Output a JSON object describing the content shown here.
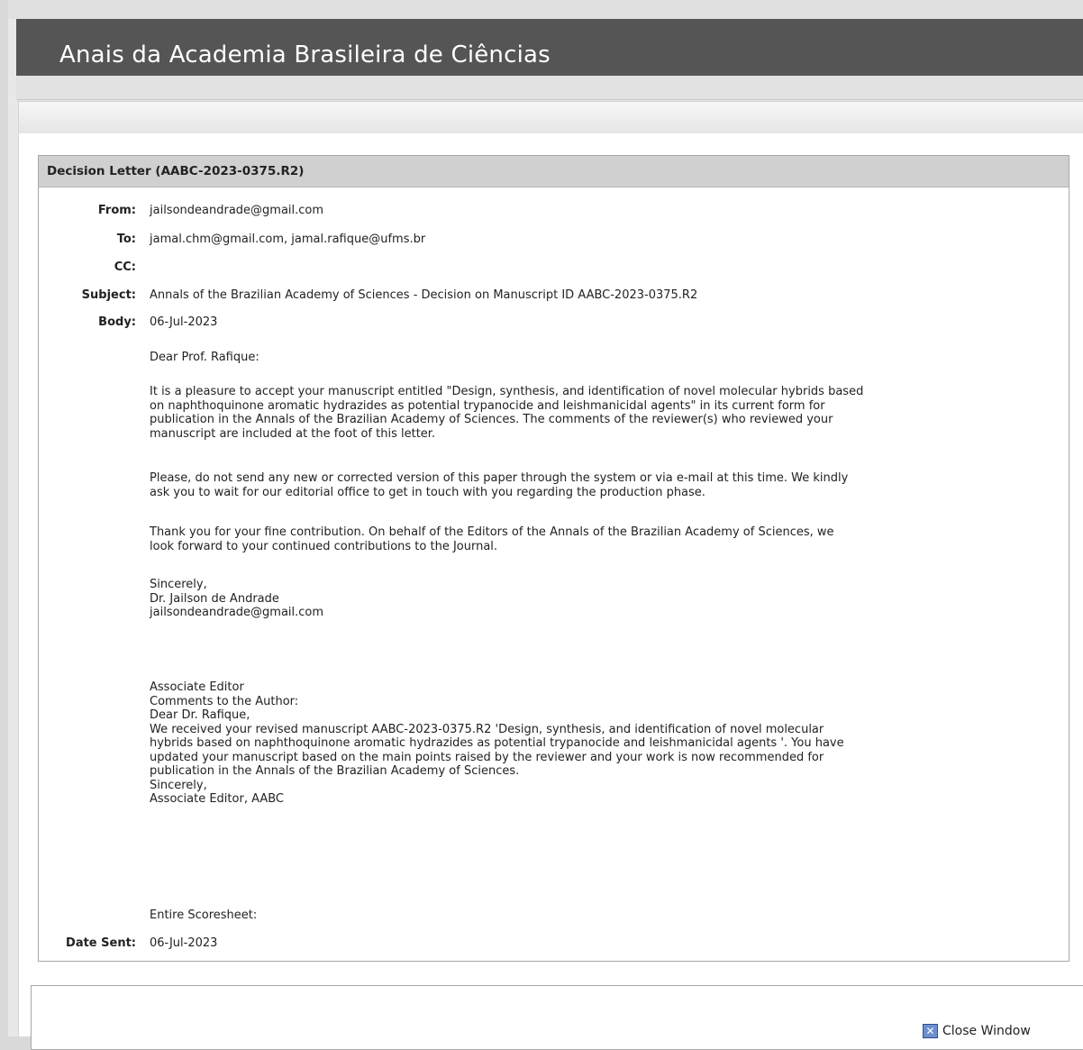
{
  "header": {
    "title": "Anais da Academia Brasileira de Ciências"
  },
  "letter": {
    "heading": "Decision Letter (AABC-2023-0375.R2)",
    "labels": {
      "from": "From:",
      "to": "To:",
      "cc": "CC:",
      "subject": "Subject:",
      "body": "Body:",
      "date_sent": "Date Sent:"
    },
    "from": "jailsondeandrade@gmail.com",
    "to": "jamal.chm@gmail.com, jamal.rafique@ufms.br",
    "cc": "",
    "subject": "Annals of the Brazilian Academy of Sciences - Decision on Manuscript ID AABC-2023-0375.R2",
    "body_date": "06-Jul-2023",
    "salutation": "Dear Prof. Rafique:",
    "para1": "It is a pleasure to accept your manuscript entitled \"Design, synthesis, and identification of novel molecular hybrids based\non naphthoquinone aromatic hydrazides as potential trypanocide and leishmanicidal agents\" in its current form for\npublication in the Annals of the Brazilian Academy of Sciences.  The comments of the reviewer(s) who reviewed your\nmanuscript are included at the foot of this letter.",
    "para2": "Please, do not send  any new or corrected version of this paper through the system or via e-mail at this time. We kindly\nask you to wait for our editorial office to get in touch with you regarding the production phase.",
    "para3": "Thank you for your fine contribution.  On behalf of the Editors of the Annals of the Brazilian Academy of Sciences, we\nlook forward to your continued contributions to the Journal.",
    "signature": "Sincerely,\nDr. Jailson de Andrade\njailsondeandrade@gmail.com",
    "comments": "Associate Editor\nComments to the Author:\nDear Dr. Rafique,\nWe received your revised manuscript AABC-2023-0375.R2 'Design, synthesis, and identification of novel molecular\nhybrids based on naphthoquinone aromatic hydrazides as potential trypanocide and leishmanicidal agents '. You have\nupdated your manuscript based on the main points raised by the reviewer and your work is now recommended for\npublication in the Annals of the Brazilian Academy of Sciences.\nSincerely,\nAssociate Editor, AABC",
    "scoresheet": "Entire Scoresheet:",
    "date_sent": "06-Jul-2023"
  },
  "footer": {
    "close_label": "Close Window",
    "close_icon": "close-icon"
  }
}
